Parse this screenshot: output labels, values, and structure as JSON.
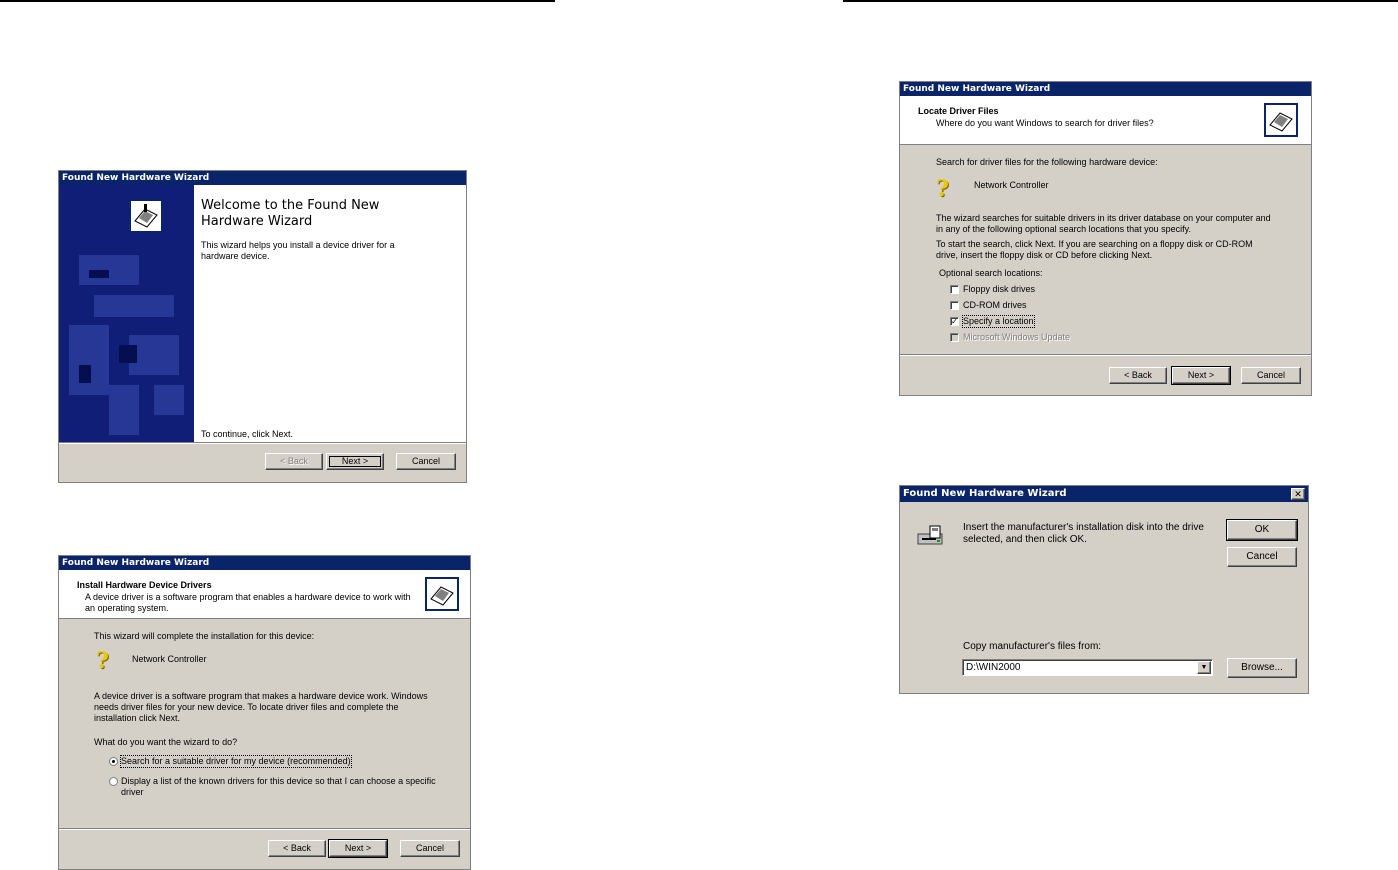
{
  "wizard1": {
    "title": "Found New Hardware Wizard",
    "heading": "Welcome to the Found New Hardware Wizard",
    "body": "This wizard helps you install a device driver for a hardware device.",
    "footer_text": "To continue, click Next.",
    "back_label": "< Back",
    "next_label": "Next >",
    "cancel_label": "Cancel"
  },
  "wizard2": {
    "title": "Found New Hardware Wizard",
    "heading": "Install Hardware Device Drivers",
    "subheading": "A device driver is a software program that enables a hardware device to work with an operating system.",
    "intro": "This wizard will complete the installation for this device:",
    "device_name": "Network Controller",
    "description": "A device driver is a software program that makes a hardware device work. Windows needs driver files for your new device. To locate driver files and complete the installation click Next.",
    "question": "What do you want the wizard to do?",
    "option_search": "Search for a suitable driver for my device (recommended)",
    "option_display": "Display a list of the known drivers for this device so that I can choose a specific driver",
    "back_label": "< Back",
    "next_label": "Next >",
    "cancel_label": "Cancel"
  },
  "wizard3": {
    "title": "Found New Hardware Wizard",
    "heading": "Locate Driver Files",
    "subheading": "Where do you want Windows to search for driver files?",
    "intro": "Search for driver files for the following hardware device:",
    "device_name": "Network Controller",
    "para1": "The wizard searches for suitable drivers in its driver database on your computer and in any of the following optional search locations that you specify.",
    "para2": "To start the search, click Next. If you are searching on a floppy disk or CD-ROM drive, insert the floppy disk or CD before clicking Next.",
    "optional_label": "Optional search locations:",
    "options": [
      {
        "label": "Floppy disk drives",
        "checked": false,
        "disabled": false
      },
      {
        "label": "CD-ROM drives",
        "checked": false,
        "disabled": false
      },
      {
        "label": "Specify a location",
        "checked": true,
        "disabled": false
      },
      {
        "label": "Microsoft Windows Update",
        "checked": false,
        "disabled": true
      }
    ],
    "back_label": "< Back",
    "next_label": "Next >",
    "cancel_label": "Cancel"
  },
  "dialog4": {
    "title": "Found New Hardware Wizard",
    "close_glyph": "✕",
    "message": "Insert the manufacturer's installation disk into the drive selected, and then click OK.",
    "ok_label": "OK",
    "cancel_label": "Cancel",
    "copy_label": "Copy manufacturer's files from:",
    "path_value": "D:\\WIN2000",
    "browse_label": "Browse...",
    "dropdown_glyph": "▼"
  }
}
